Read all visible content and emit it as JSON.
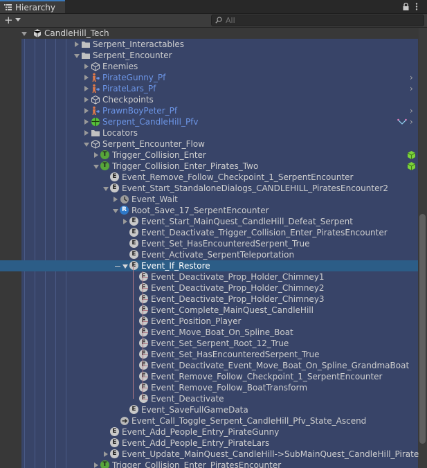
{
  "window": {
    "tab_label": "Hierarchy",
    "lock_icon": "lock-icon",
    "menu_icon": "kebab-menu-icon"
  },
  "toolbar": {
    "add_label": "+",
    "search_placeholder": "All"
  },
  "colors": {
    "tree_background": "#384468",
    "selected_row": "#2c5d87",
    "prefab_text": "#6c95e6",
    "trigger_green": "#57a63a",
    "root_blue": "#2f79c8",
    "pink_guide": "#b07a86"
  },
  "tree": {
    "rows": [
      {
        "label": "CandleHill_Tech"
      },
      {
        "label": "Serpent_Interactables"
      },
      {
        "label": "Serpent_Encounter"
      },
      {
        "label": "Enemies"
      },
      {
        "label": "PirateGunny_Pf"
      },
      {
        "label": "PirateLars_Pf"
      },
      {
        "label": "Checkpoints"
      },
      {
        "label": "PrawnBoyPeter_Pf"
      },
      {
        "label": "Serpent_CandleHill_Pfv"
      },
      {
        "label": "Locators"
      },
      {
        "label": "Serpent_Encounter_Flow"
      },
      {
        "label": "Trigger_Collision_Enter"
      },
      {
        "label": "Trigger_Collision_Enter_Pirates_Two"
      },
      {
        "label": "Event_Remove_Follow_Checkpoint_1_SerpentEncounter"
      },
      {
        "label": "Event_Start_StandaloneDialogs_CANDLEHILL_PiratesEncounter2"
      },
      {
        "label": "Event_Wait"
      },
      {
        "label": "Root_Save_17_SerpentEncounter"
      },
      {
        "label": "Event_Start_MainQuest_CandleHill_Defeat_Serpent"
      },
      {
        "label": "Event_Deactivate_Trigger_Collision_Enter_PiratesEncounter"
      },
      {
        "label": "Event_Set_HasEncounteredSerpent_True"
      },
      {
        "label": "Event_Activate_SerpentTeleportation"
      },
      {
        "label": "Event_If_Restore"
      },
      {
        "label": "Event_Deactivate_Prop_Holder_Chimney1"
      },
      {
        "label": "Event_Deactivate_Prop_Holder_Chimney2"
      },
      {
        "label": "Event_Deactivate_Prop_Holder_Chimney3"
      },
      {
        "label": "Event_Complete_MainQuest_CandleHill"
      },
      {
        "label": "Event_Position_Player"
      },
      {
        "label": "Event_Move_Boat_On_Spline_Boat"
      },
      {
        "label": "Event_Set_Serpent_Root_12_True"
      },
      {
        "label": "Event_Set_HasEncounteredSerpent_True"
      },
      {
        "label": "Event_Deactivate_Event_Move_Boat_On_Spline_GrandmaBoat"
      },
      {
        "label": "Event_Remove_Follow_Checkpoint_1_SerpentEncounter"
      },
      {
        "label": "Event_Remove_Follow_BoatTransform"
      },
      {
        "label": "Event_Deactivate"
      },
      {
        "label": "Event_SaveFullGameData"
      },
      {
        "label": "Event_Call_Toggle_Serpent_CandleHill_Pfv_State_Ascend"
      },
      {
        "label": "Event_Add_People_Entry_PirateGunny"
      },
      {
        "label": "Event_Add_People_Entry_PirateLars"
      },
      {
        "label": "Event_Update_MainQuest_CandleHill->SubMainQuest_CandleHill_PiratesMe"
      },
      {
        "label": "Trigger_Collision_Enter_PiratesEncounter"
      }
    ]
  }
}
